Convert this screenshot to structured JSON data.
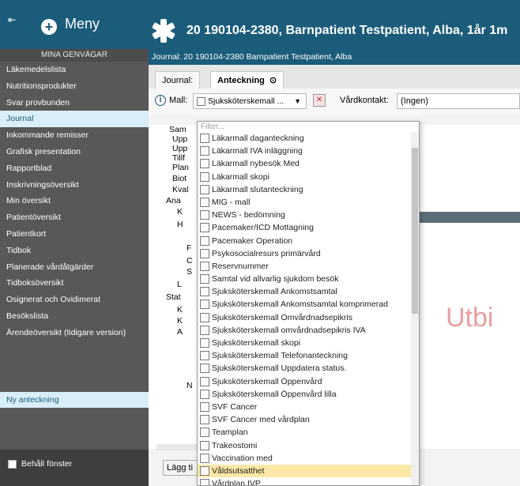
{
  "topbar": {
    "menu_label": "Meny",
    "patient_title": "20 190104-2380,  Barnpatient Testpatient, Alba,  1år 1m"
  },
  "sidebar": {
    "header": "MINA GENVÄGAR",
    "items": [
      {
        "label": "Läkemedelslista",
        "active": false
      },
      {
        "label": "Nutritionsprodukter",
        "active": false
      },
      {
        "label": "Svar provbunden",
        "active": false
      },
      {
        "label": "Journal",
        "active": true
      },
      {
        "label": "Inkommande remisser",
        "active": false
      },
      {
        "label": "Grafisk presentation",
        "active": false
      },
      {
        "label": "Rapportblad",
        "active": false
      },
      {
        "label": "Inskrivningsöversikt",
        "active": false
      },
      {
        "label": "Min översikt",
        "active": false
      },
      {
        "label": "Patientöversikt",
        "active": false
      },
      {
        "label": "Patientkort",
        "active": false
      },
      {
        "label": "Tidbok",
        "active": false
      },
      {
        "label": "Planerade vårdåtgärder",
        "active": false
      },
      {
        "label": "Tidboksöversikt",
        "active": false
      },
      {
        "label": "Osignerat och Ovidimerat",
        "active": false
      },
      {
        "label": "Besökslista",
        "active": false
      },
      {
        "label": "Ärendeöversikt (tidigare version)",
        "active": false
      }
    ],
    "new_note": "Ny anteckning",
    "keep_window": "Behåll fönster"
  },
  "content": {
    "journal_bar": "Journal: 20 190104-2380 Barnpatient Testpatient, Alba",
    "tabs": {
      "journal": "Journal:",
      "note": "Anteckning"
    },
    "toolbar": {
      "mall_label": "Mall:",
      "mall_value": "Sjuksköterskemall ...",
      "vardkontakt_label": "Vårdkontakt:",
      "vardkontakt_value": "(Ingen)"
    },
    "tree": [
      "Sam",
      "Upp",
      "Upp",
      "Tillf",
      "Plan",
      "Biot",
      "Kval",
      "Ana",
      "K",
      "H",
      "F",
      "C",
      "S",
      "L",
      "Stat",
      "K",
      "K",
      "A",
      "N"
    ],
    "big_text": "Utbi",
    "add_button": "Lägg ti"
  },
  "dropdown": {
    "filter_placeholder": "Filter...",
    "options": [
      "Läkarmall daganteckning",
      "Läkarmall IVA inläggning",
      "Läkarmall nybesök Med",
      "Läkarmall skopi",
      "Läkarmall slutanteckning",
      "MIG - mall",
      "NEWS - bedömning",
      "Pacemaker/ICD Mottagning",
      "Pacemaker Operation",
      "Psykosocialresurs primärvård",
      "Reservnummer",
      "Samtal vid allvarlig sjukdom besök",
      "Sjuksköterskemall Ankomstsamtal",
      "Sjuksköterskemall Ankomstsamtal komprimerad",
      "Sjuksköterskemall Omvårdnadsepikris",
      "Sjuksköterskemall omvårdnadsepikris IVA",
      "Sjuksköterskemall skopi",
      "Sjuksköterskemall Telefonanteckning",
      "Sjuksköterskemall Uppdatera status.",
      "Sjuksköterskemall Öppenvård",
      "Sjuksköterskemall Öppenvård lilla",
      "SVF Cancer",
      "SVF Cancer med vårdplan",
      "Teamplan",
      "Trakeostomi",
      "Vaccination med",
      "Våldsutsatthet",
      "Vårdplan IVP"
    ],
    "selected_index": 26
  },
  "colors": {
    "brand": "#1b5c7a",
    "sidebar_bg": "#585858",
    "active_bg": "#d9eef8",
    "selected_bg": "#fbe8a6"
  }
}
